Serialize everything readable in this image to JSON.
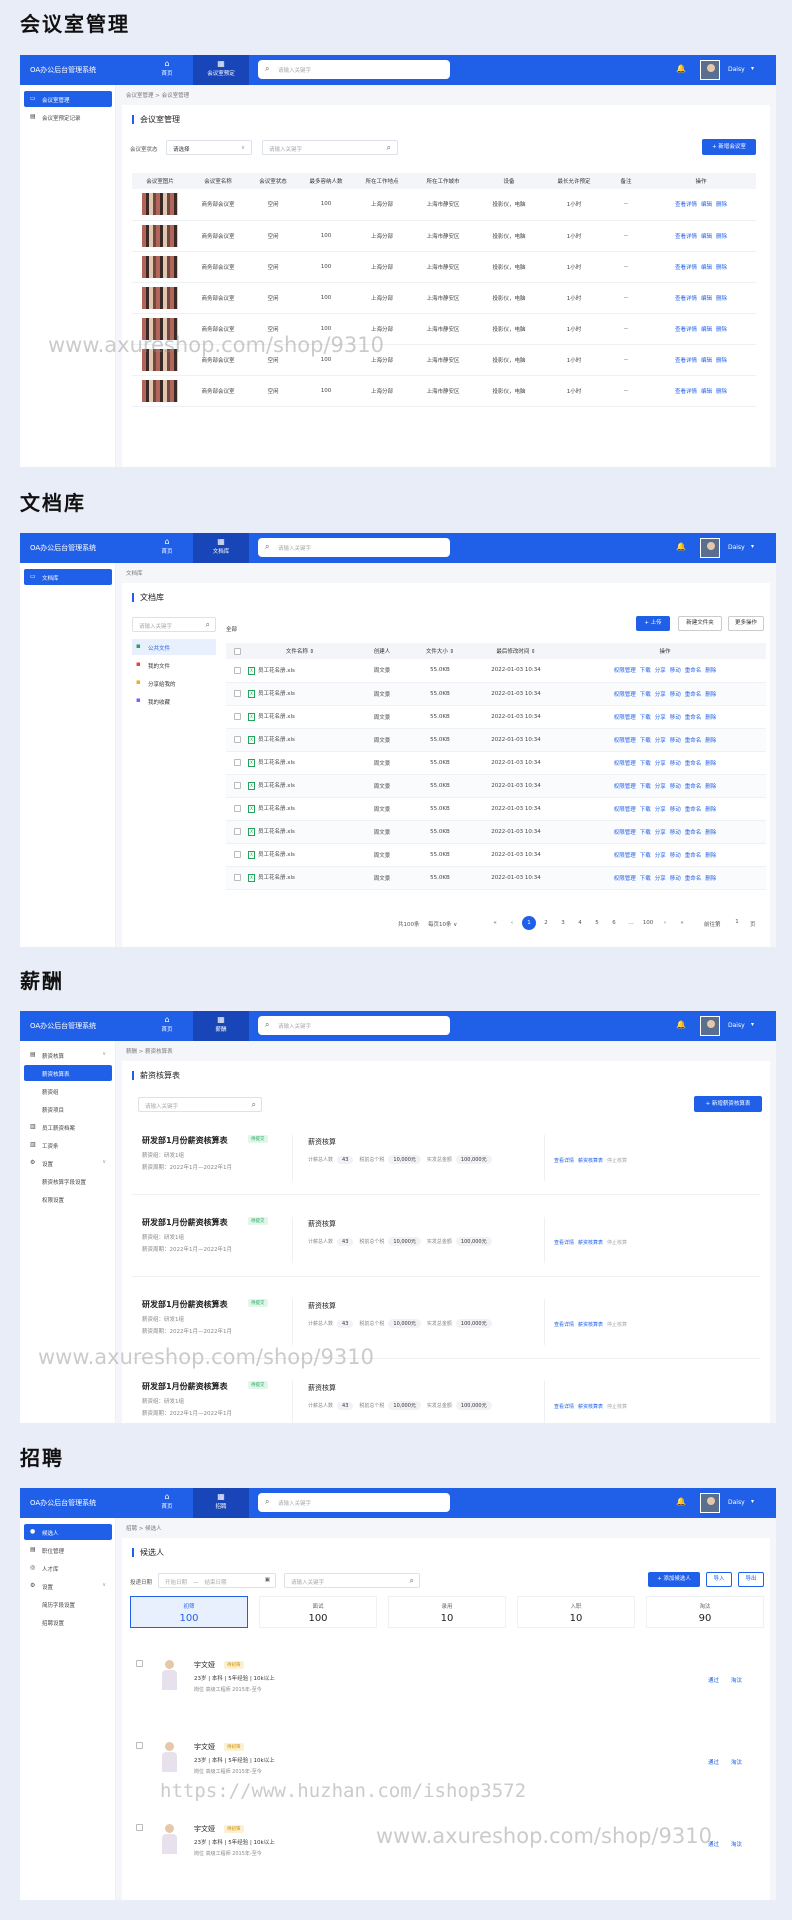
{
  "sections": [
    {
      "title": "会议室管理"
    },
    {
      "title": "文档库"
    },
    {
      "title": "薪酬"
    },
    {
      "title": "招聘"
    }
  ],
  "app": {
    "brand_meeting": "OA办公后台管理系统",
    "brand": "OA办公后台管理系统",
    "nav_home": "首页",
    "nav_meeting": "会议室预定",
    "nav_docs": "文档库",
    "nav_salary": "薪酬",
    "nav_recruit": "招聘",
    "search_placeholder": "请输入关键字",
    "username": "Daisy"
  },
  "meeting": {
    "sidebar": [
      "会议室管理",
      "会议室预定记录"
    ],
    "breadcrumb": "会议室管理 > 会议室管理",
    "title": "会议室管理",
    "filter_label": "会议室状态",
    "filter_value": "请选择",
    "search_placeholder": "请输入关键字",
    "add_button": "+ 新增会议室",
    "columns": [
      "会议室图片",
      "会议室名称",
      "会议室状态",
      "最多容纳人数",
      "所在工作地点",
      "所在工作城市",
      "设备",
      "最长允许预定",
      "备注",
      "操作"
    ],
    "rows": [
      {
        "name": "商务部会议室",
        "status": "空闲",
        "cap": "100",
        "site": "上海分部",
        "city": "上海市静安区",
        "equip": "投影仪，电脑",
        "max": "1小时",
        "note": "--"
      },
      {
        "name": "商务部会议室",
        "status": "空闲",
        "cap": "100",
        "site": "上海分部",
        "city": "上海市静安区",
        "equip": "投影仪，电脑",
        "max": "1小时",
        "note": "--"
      },
      {
        "name": "商务部会议室",
        "status": "空闲",
        "cap": "100",
        "site": "上海分部",
        "city": "上海市静安区",
        "equip": "投影仪，电脑",
        "max": "1小时",
        "note": "--"
      },
      {
        "name": "商务部会议室",
        "status": "空闲",
        "cap": "100",
        "site": "上海分部",
        "city": "上海市静安区",
        "equip": "投影仪，电脑",
        "max": "1小时",
        "note": "--"
      },
      {
        "name": "商务部会议室",
        "status": "空闲",
        "cap": "100",
        "site": "上海分部",
        "city": "上海市静安区",
        "equip": "投影仪，电脑",
        "max": "1小时",
        "note": "--"
      },
      {
        "name": "商务部会议室",
        "status": "空闲",
        "cap": "100",
        "site": "上海分部",
        "city": "上海市静安区",
        "equip": "投影仪，电脑",
        "max": "1小时",
        "note": "--"
      },
      {
        "name": "商务部会议室",
        "status": "空闲",
        "cap": "100",
        "site": "上海分部",
        "city": "上海市静安区",
        "equip": "投影仪，电脑",
        "max": "1小时",
        "note": "--"
      }
    ],
    "actions": [
      "查看详情",
      "编辑",
      "删除"
    ]
  },
  "docs": {
    "sidebar": [
      "文档库"
    ],
    "breadcrumb": "文档库",
    "title": "文档库",
    "search_placeholder": "请输入关键字",
    "tree": [
      "公共文件",
      "我的文件",
      "分享给我的",
      "我的收藏"
    ],
    "buttons": [
      "+ 上传",
      "新建文件夹",
      "更多操作"
    ],
    "all_label": "全部",
    "columns": [
      "",
      "文件名称 ⇕",
      "创建人",
      "文件大小 ⇕",
      "最后修改时间 ⇕",
      "操作"
    ],
    "rows": [
      {
        "file": "员工花名册.xls",
        "creator": "周文景",
        "size": "55.0KB",
        "time": "2022-01-03 10:34"
      },
      {
        "file": "员工花名册.xls",
        "creator": "周文景",
        "size": "55.0KB",
        "time": "2022-01-03 10:34"
      },
      {
        "file": "员工花名册.xls",
        "creator": "周文景",
        "size": "55.0KB",
        "time": "2022-01-03 10:34"
      },
      {
        "file": "员工花名册.xls",
        "creator": "周文景",
        "size": "55.0KB",
        "time": "2022-01-03 10:34"
      },
      {
        "file": "员工花名册.xls",
        "creator": "周文景",
        "size": "55.0KB",
        "time": "2022-01-03 10:34"
      },
      {
        "file": "员工花名册.xls",
        "creator": "周文景",
        "size": "55.0KB",
        "time": "2022-01-03 10:34"
      },
      {
        "file": "员工花名册.xls",
        "creator": "周文景",
        "size": "55.0KB",
        "time": "2022-01-03 10:34"
      },
      {
        "file": "员工花名册.xls",
        "creator": "周文景",
        "size": "55.0KB",
        "time": "2022-01-03 10:34"
      },
      {
        "file": "员工花名册.xls",
        "creator": "周文景",
        "size": "55.0KB",
        "time": "2022-01-03 10:34"
      },
      {
        "file": "员工花名册.xls",
        "creator": "周文景",
        "size": "55.0KB",
        "time": "2022-01-03 10:34"
      }
    ],
    "actions": [
      "权限管理",
      "下载",
      "分享",
      "移动",
      "重命名",
      "删除"
    ],
    "pager": {
      "total": "共100条",
      "per_page": "每页10条 ∨",
      "pages": [
        "«",
        "‹",
        "1",
        "2",
        "3",
        "4",
        "5",
        "6",
        "…",
        "100",
        "›",
        "»"
      ],
      "current": "1",
      "goto_label": "前往第",
      "goto_value": "1",
      "page_suffix": "页"
    }
  },
  "salary": {
    "sidebar": [
      {
        "label": "薪资核算",
        "icon": "calc-icon"
      },
      {
        "label": "薪资核算表",
        "icon": ""
      },
      {
        "label": "薪资组",
        "icon": ""
      },
      {
        "label": "薪资项目",
        "icon": ""
      },
      {
        "label": "员工薪资档案",
        "icon": "file-icon"
      },
      {
        "label": "工资条",
        "icon": "doc-icon"
      },
      {
        "label": "设置",
        "icon": "gear-icon"
      },
      {
        "label": "薪资核算字段设置",
        "icon": ""
      },
      {
        "label": "权限设置",
        "icon": ""
      }
    ],
    "breadcrumb": "薪酬 > 薪资核算表",
    "title": "薪资核算表",
    "search_placeholder": "请输入关键字",
    "add_button": "+ 新增薪资核算表",
    "cards": [
      {
        "name": "研发部1月份薪资核算表",
        "badge": "待提交",
        "group": "薪资组：研发1组",
        "period": "薪资周期：2022年1月—2022年1月",
        "head": "薪资核算",
        "count": "43",
        "pre_tax": "10,000元",
        "payable": "100,000元"
      },
      {
        "name": "研发部1月份薪资核算表",
        "badge": "待提交",
        "group": "薪资组：研发1组",
        "period": "薪资周期：2022年1月—2022年1月",
        "head": "薪资核算",
        "count": "43",
        "pre_tax": "10,000元",
        "payable": "100,000元"
      },
      {
        "name": "研发部1月份薪资核算表",
        "badge": "待提交",
        "group": "薪资组：研发1组",
        "period": "薪资周期：2022年1月—2022年1月",
        "head": "薪资核算",
        "count": "43",
        "pre_tax": "10,000元",
        "payable": "100,000元"
      },
      {
        "name": "研发部1月份薪资核算表",
        "badge": "待提交",
        "group": "薪资组：研发1组",
        "period": "薪资周期：2022年1月—2022年1月",
        "head": "薪资核算",
        "count": "43",
        "pre_tax": "10,000元",
        "payable": "100,000元"
      }
    ],
    "labels": {
      "count": "计薪总人数",
      "pre_tax": "税前总个税",
      "payable": "实发总金额"
    },
    "actions": [
      "查看详情",
      "薪资核算表",
      "停止核算"
    ]
  },
  "recruit": {
    "sidebar": [
      {
        "label": "候选人",
        "icon": "person-icon"
      },
      {
        "label": "职位管理",
        "icon": "doc-icon"
      },
      {
        "label": "人才库",
        "icon": "people-icon"
      },
      {
        "label": "设置",
        "icon": "gear-icon"
      },
      {
        "label": "简历字段设置",
        "icon": ""
      },
      {
        "label": "招聘设置",
        "icon": ""
      }
    ],
    "breadcrumb": "招聘 > 候选人",
    "title": "候选人",
    "filter_label": "投递日期",
    "date_start": "开始日期",
    "date_end": "结束日期",
    "search_placeholder": "请输入关键字",
    "buttons": [
      "+ 添加候选人",
      "导入",
      "导出"
    ],
    "stats": [
      {
        "label": "初筛",
        "value": "100"
      },
      {
        "label": "面试",
        "value": "100"
      },
      {
        "label": "录用",
        "value": "10"
      },
      {
        "label": "入职",
        "value": "10"
      },
      {
        "label": "淘汰",
        "value": "90"
      }
    ],
    "candidates": [
      {
        "name": "宇文娅",
        "badge": "待初筛",
        "info": "23岁 | 本科 | 5年经验 | 10k以上",
        "job": "岗位    高级工程师    2015年-至今"
      },
      {
        "name": "宇文娅",
        "badge": "待初筛",
        "info": "23岁 | 本科 | 5年经验 | 10k以上",
        "job": "岗位    高级工程师    2015年-至今"
      },
      {
        "name": "宇文娅",
        "badge": "待初筛",
        "info": "23岁 | 本科 | 5年经验 | 10k以上",
        "job": "岗位    高级工程师    2015年-至今"
      }
    ],
    "actions": [
      "通过",
      "淘汰"
    ]
  },
  "watermarks": [
    "www.axureshop.com/shop/9310",
    "www.axureshop.com/shop/9310",
    "https://www.huzhan.com/ishop3572",
    "www.axureshop.com/shop/9310"
  ]
}
